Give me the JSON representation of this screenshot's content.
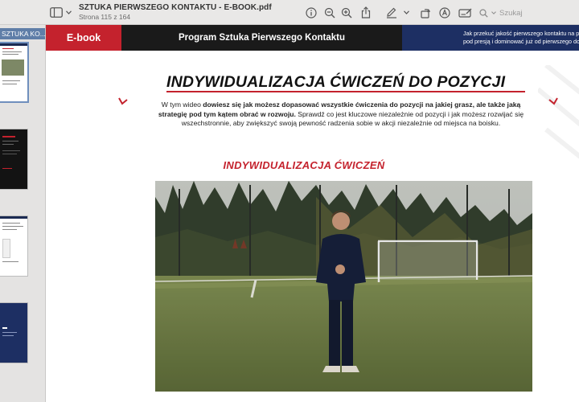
{
  "window": {
    "file_name": "SZTUKA PIERWSZEGO KONTAKTU - E-BOOK.pdf",
    "page_info": "Strona 115 z 164",
    "search_placeholder": "Szukaj"
  },
  "sidebar": {
    "label": "SZTUKA KO..."
  },
  "document": {
    "header": {
      "tag": "E-book",
      "program": "Program Sztuka Pierwszego Kontaktu",
      "tagline_1": "Jak przekuć jakość pierwszego kontaktu na przewa",
      "tagline_2": "pod presją i dominować już od pierwszego dotknię"
    },
    "title": "INDYWIDUALIZACJA ĆWICZEŃ DO POZYCJI",
    "intro": {
      "p1_a": "W tym wideo ",
      "p1_b": "dowiesz się jak możesz dopasować wszystkie ćwiczenia do pozycji na jakiej grasz, ale także jaką strategię pod tym kątem obrać w rozwoju.",
      "p1_c": " Sprawdź co jest kluczowe niezależnie od pozycji i jak możesz rozwijać się wszechstronnie, aby zwiększyć swoją pewność radzenia sobie w akcji niezależnie od miejsca na boisku."
    },
    "subtitle": "INDYWIDUALIZACJA ĆWICZEŃ"
  },
  "colors": {
    "brand_red": "#c4222d",
    "brand_navy": "#1d2f63",
    "header_black": "#1a1a1a"
  }
}
